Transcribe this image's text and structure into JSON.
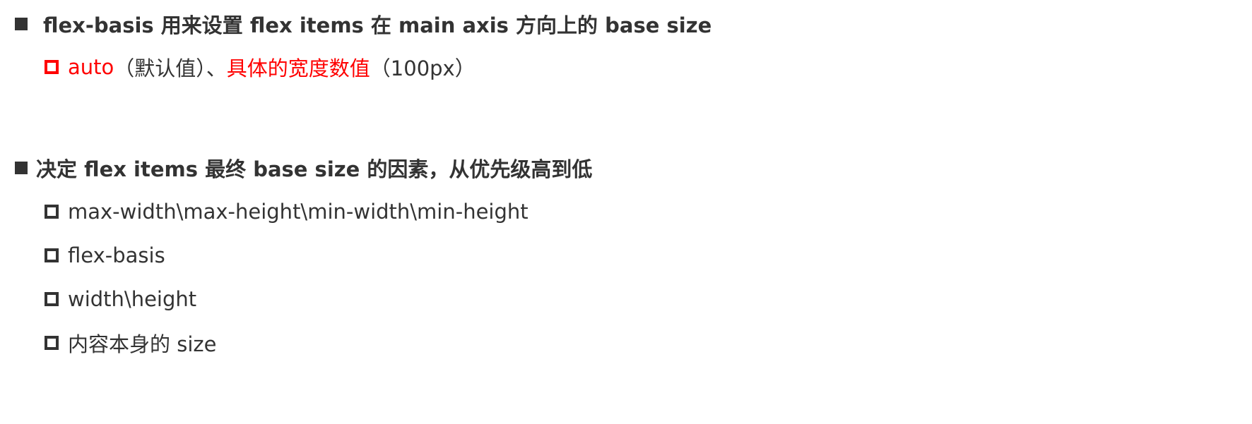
{
  "section1": {
    "heading": "flex-basis 用来设置 flex items 在 main axis 方向上的 base size",
    "item": {
      "part1": "auto",
      "part2": "（默认值）、",
      "part3": "具体的宽度数值",
      "part4": "（100px）"
    }
  },
  "section2": {
    "heading": "决定 flex items 最终 base size 的因素，从优先级高到低",
    "items": [
      "max-width\\max-height\\min-width\\min-height",
      "flex-basis",
      "width\\height",
      "内容本身的 size"
    ]
  },
  "colors": {
    "text": "#333333",
    "highlight": "#ff0000"
  }
}
